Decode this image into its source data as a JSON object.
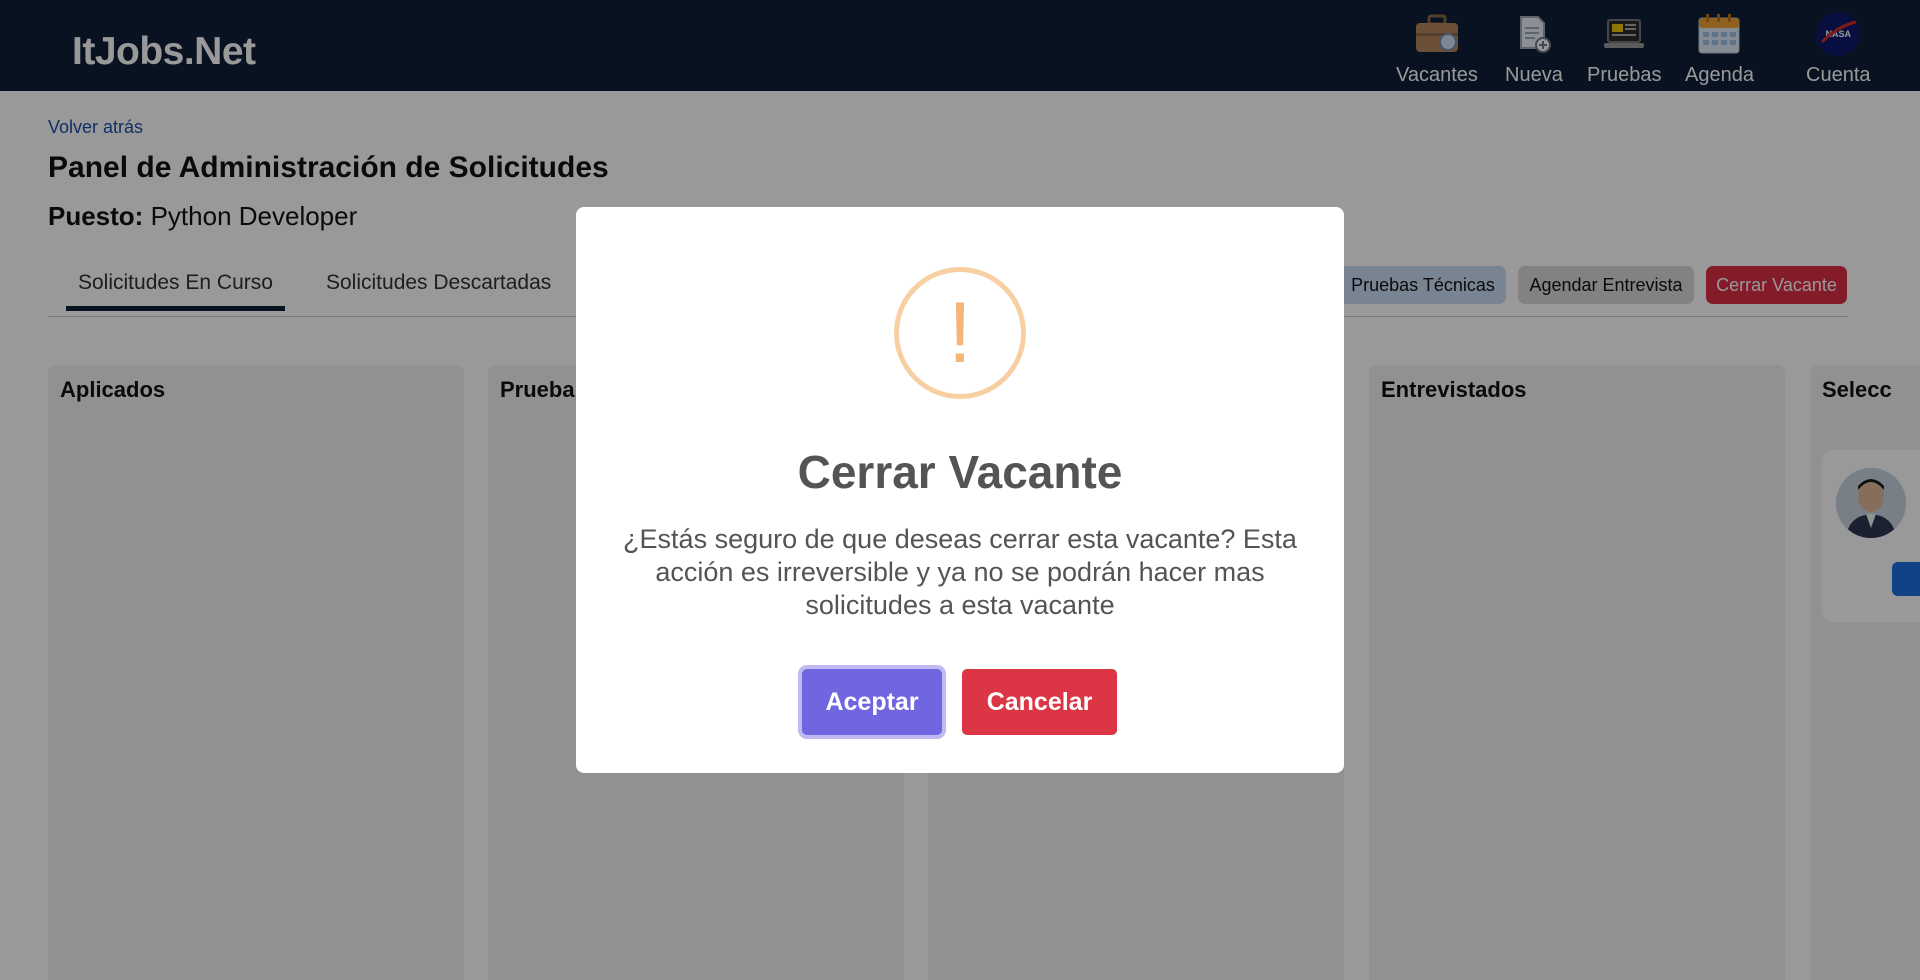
{
  "header": {
    "brand": "ItJobs.Net",
    "nav": [
      {
        "label": "Vacantes",
        "icon": "briefcase-icon"
      },
      {
        "label": "Nueva",
        "icon": "new-document-icon"
      },
      {
        "label": "Pruebas",
        "icon": "laptop-code-icon"
      },
      {
        "label": "Agenda",
        "icon": "calendar-icon"
      }
    ],
    "account": {
      "label": "Cuenta",
      "avatar_text": "NASA"
    }
  },
  "page": {
    "back_link": "Volver atrás",
    "title": "Panel de Administración de Solicitudes",
    "puesto_label": "Puesto:",
    "puesto_value": "Python Developer",
    "tabs": [
      {
        "label": "Solicitudes En Curso",
        "active": true
      },
      {
        "label": "Solicitudes Descartadas",
        "active": false
      }
    ],
    "actions": {
      "pruebas": "Pruebas Técnicas",
      "agendar": "Agendar Entrevista",
      "cerrar": "Cerrar Vacante"
    },
    "columns": [
      "Aplicados",
      "Prueba",
      "",
      "Entrevistados",
      "Selecc"
    ]
  },
  "modal": {
    "icon_glyph": "!",
    "title": "Cerrar Vacante",
    "message": "¿Estás seguro de que deseas cerrar esta vacante? Esta acción es irreversible y ya no se podrán hacer mas solicitudes a esta vacante",
    "confirm": "Aceptar",
    "cancel": "Cancelar"
  },
  "colors": {
    "header_bg": "#0f1f38",
    "danger": "#dc3545",
    "confirm": "#7066e0",
    "warning": "#f8bb86"
  }
}
